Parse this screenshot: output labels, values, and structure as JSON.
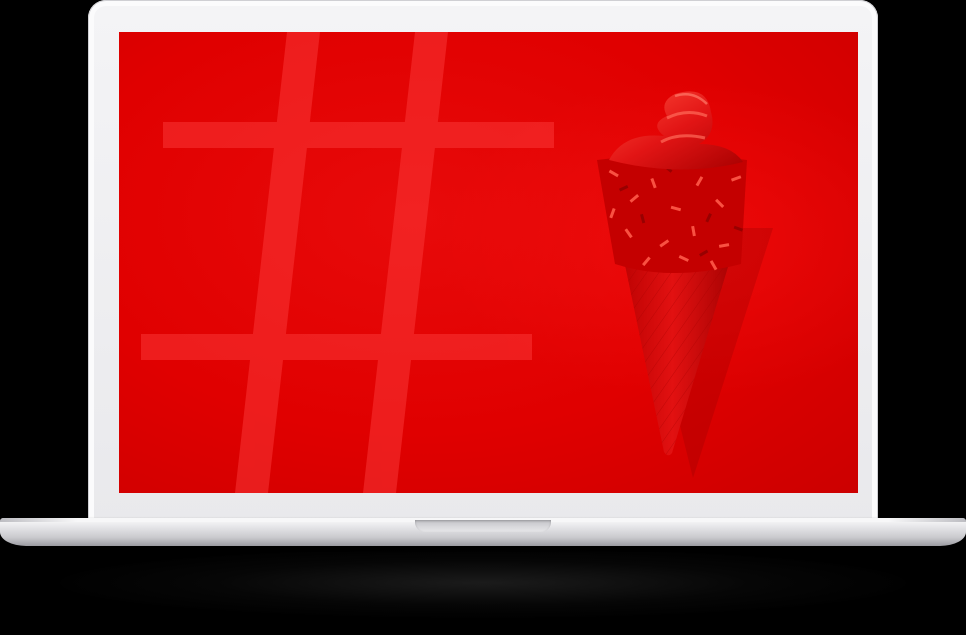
{
  "device": {
    "type": "laptop",
    "bezel_color": "#f0f0f2"
  },
  "screen": {
    "background_color": "#e00000",
    "graphic": {
      "hash_symbol_color": "#ff3b3b",
      "icon": "hash-icon"
    },
    "image": {
      "subject": "red-ice-cream-cone-icon",
      "cone_color": "#d10000",
      "swirl_color": "#e51b1b"
    }
  }
}
